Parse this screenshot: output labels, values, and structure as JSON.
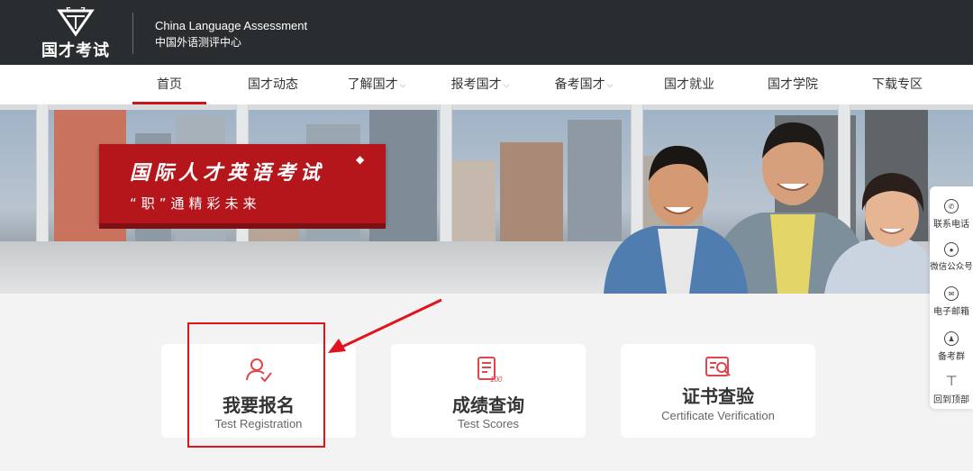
{
  "header": {
    "logo_text": "国才考试",
    "brand_en": "China Language Assessment",
    "brand_zh": "中国外语测评中心"
  },
  "nav": {
    "items": [
      {
        "label": "首页",
        "active": true
      },
      {
        "label": "国才动态"
      },
      {
        "label": "了解国才",
        "dropdown": true
      },
      {
        "label": "报考国才",
        "dropdown": true
      },
      {
        "label": "备考国才",
        "dropdown": true
      },
      {
        "label": "国才就业"
      },
      {
        "label": "国才学院"
      },
      {
        "label": "下载专区"
      }
    ],
    "caret": "⌵"
  },
  "banner": {
    "title": "国际人才英语考试",
    "subtitle": "“职”通精彩未来"
  },
  "cards": [
    {
      "title": "我要报名",
      "subtitle": "Test Registration",
      "icon": "user-check-icon"
    },
    {
      "title": "成绩查询",
      "subtitle": "Test Scores",
      "icon": "score-sheet-icon"
    },
    {
      "title": "证书查验",
      "subtitle": "Certificate Verification",
      "icon": "certificate-search-icon"
    }
  ],
  "floatbar": {
    "items": [
      {
        "label": "联系电话",
        "icon": "phone-icon"
      },
      {
        "label": "微信公众号",
        "icon": "wechat-icon"
      },
      {
        "label": "电子邮箱",
        "icon": "email-icon"
      },
      {
        "label": "备考群",
        "icon": "qq-icon"
      },
      {
        "label": "回到顶部",
        "icon": "back-to-top-icon"
      }
    ]
  },
  "colors": {
    "accent": "#c8161d",
    "header_bg": "#2a2d30",
    "annotation": "#e1141e"
  }
}
